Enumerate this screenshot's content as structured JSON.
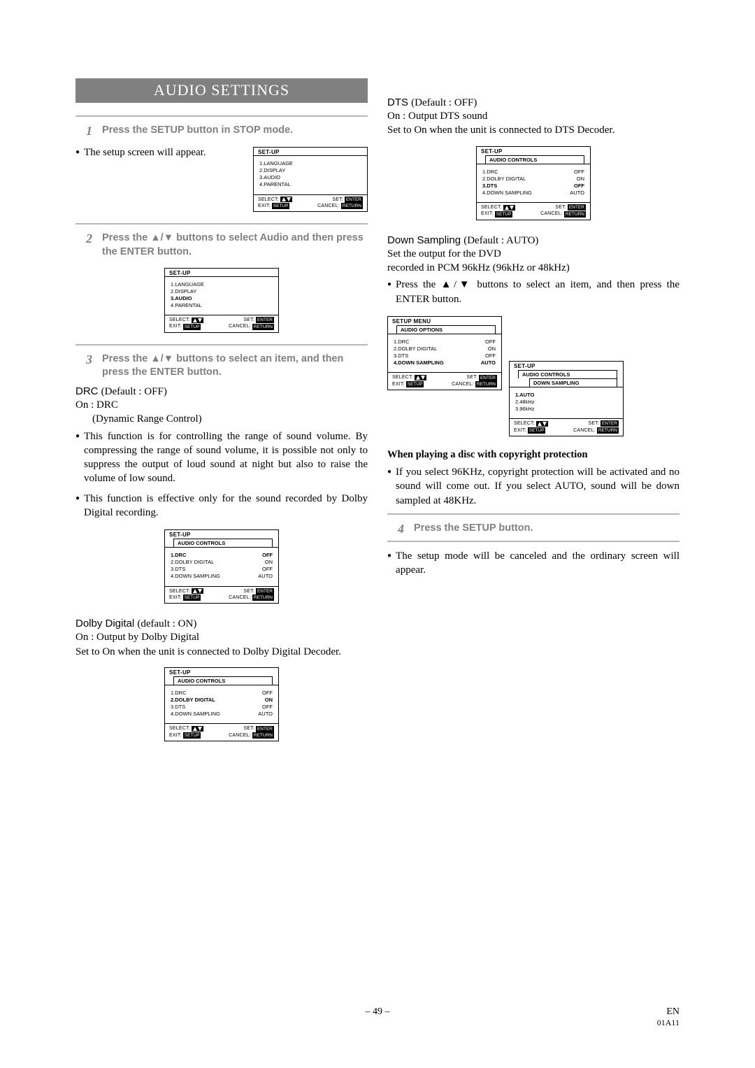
{
  "title": "AUDIO SETTINGS",
  "step1": {
    "num": "1",
    "text": "Press the SETUP button in STOP mode."
  },
  "step1_note": "The setup screen will appear.",
  "step2": {
    "num": "2",
    "text": "Press the ▲/▼ buttons to select Audio and then press the ENTER button."
  },
  "step3": {
    "num": "3",
    "text": "Press the ▲/▼ buttons to select an item, and then press the ENTER button."
  },
  "step4": {
    "num": "4",
    "text": "Press the SETUP button."
  },
  "osd_setup_title": "SET-UP",
  "osd_audio_controls": "AUDIO CONTROLS",
  "osd_setup_menu": "SETUP MENU",
  "osd_audio_options": "AUDIO OPTIONS",
  "osd_down_sampling": "DOWN SAMPLING",
  "menu_main": [
    {
      "label": "1.LANGUAGE",
      "bold": false
    },
    {
      "label": "2.DISPLAY",
      "bold": false
    },
    {
      "label": "3.AUDIO",
      "bold": false
    },
    {
      "label": "4.PARENTAL",
      "bold": false
    }
  ],
  "menu_main_sel": [
    {
      "label": "1.LANGUAGE",
      "bold": false
    },
    {
      "label": "2.DISPLAY",
      "bold": false
    },
    {
      "label": "3.AUDIO",
      "bold": true
    },
    {
      "label": "4.PARENTAL",
      "bold": false
    }
  ],
  "audio_rows_drc": [
    {
      "label": "1.DRC",
      "val": "OFF",
      "bold": true
    },
    {
      "label": "2.DOLBY DIGITAL",
      "val": "ON",
      "bold": false
    },
    {
      "label": "3.DTS",
      "val": "OFF",
      "bold": false
    },
    {
      "label": "4.DOWN SAMPLING",
      "val": "AUTO",
      "bold": false
    }
  ],
  "audio_rows_dolby": [
    {
      "label": "1.DRC",
      "val": "OFF",
      "bold": false
    },
    {
      "label": "2.DOLBY DIGITAL",
      "val": "ON",
      "bold": true
    },
    {
      "label": "3.DTS",
      "val": "OFF",
      "bold": false
    },
    {
      "label": "4.DOWN SAMPLING",
      "val": "AUTO",
      "bold": false
    }
  ],
  "audio_rows_dts": [
    {
      "label": "1.DRC",
      "val": "OFF",
      "bold": false
    },
    {
      "label": "2.DOLBY DIGITAL",
      "val": "ON",
      "bold": false
    },
    {
      "label": "3.DTS",
      "val": "OFF",
      "bold": true
    },
    {
      "label": "4.DOWN SAMPLING",
      "val": "AUTO",
      "bold": false
    }
  ],
  "audio_rows_downs": [
    {
      "label": "1.DRC",
      "val": "OFF",
      "bold": false
    },
    {
      "label": "2.DOLBY DIGITAL",
      "val": "ON",
      "bold": false
    },
    {
      "label": "3.DTS",
      "val": "OFF",
      "bold": false
    },
    {
      "label": "4.DOWN SAMPLING",
      "val": "AUTO",
      "bold": true
    }
  ],
  "sampling_rows": [
    {
      "label": "1.AUTO",
      "bold": true
    },
    {
      "label": "2.48kHz",
      "bold": false
    },
    {
      "label": "3.96kHz",
      "bold": false
    }
  ],
  "foot": {
    "select": "SELECT:",
    "exit": "EXIT:",
    "set": "SET:",
    "cancel": "CANCEL:",
    "enter": "ENTER",
    "return": "RETURN",
    "setup": "SETUP"
  },
  "drc": {
    "title_lead": "DRC",
    "title_def": "(Default : OFF)",
    "line2": "On : DRC",
    "line3": "(Dynamic Range Control)",
    "p1": "This function is for controlling the range of sound volume. By compressing the range of sound volume, it is possible not only to suppress the output of loud sound at night but also to raise the volume of low sound.",
    "p2": "This function is effective only for the sound recorded by Dolby Digital recording."
  },
  "dolby": {
    "title_lead": "Dolby Digital",
    "title_def": "(default : ON)",
    "line2": "On : Output by Dolby Digital",
    "p1": "Set to On when the unit is connected to Dolby Digital Decoder."
  },
  "dts": {
    "title_lead": "DTS",
    "title_def": "(Default : OFF)",
    "line2": "On : Output DTS sound",
    "p1": "Set to On when the unit is connected to DTS Decoder."
  },
  "downs": {
    "title_lead": "Down Sampling",
    "title_def": "(Default : AUTO)",
    "line2": "Set the output for the DVD",
    "line3": "recorded in PCM 96kHz (96kHz or 48kHz)",
    "p1": "Press the ▲/▼ buttons to select an item, and then press the ENTER button."
  },
  "copy_head": "When playing a disc with copyright  protection",
  "copy_p": "If you select 96KHz, copyright protection will be activated and no sound will come out. If you select AUTO, sound will be down sampled at 48KHz.",
  "step4_note": "The setup mode will be canceled and the ordinary screen will appear.",
  "page_num": "– 49 –",
  "lang_code": "EN",
  "print_code": "01A11"
}
